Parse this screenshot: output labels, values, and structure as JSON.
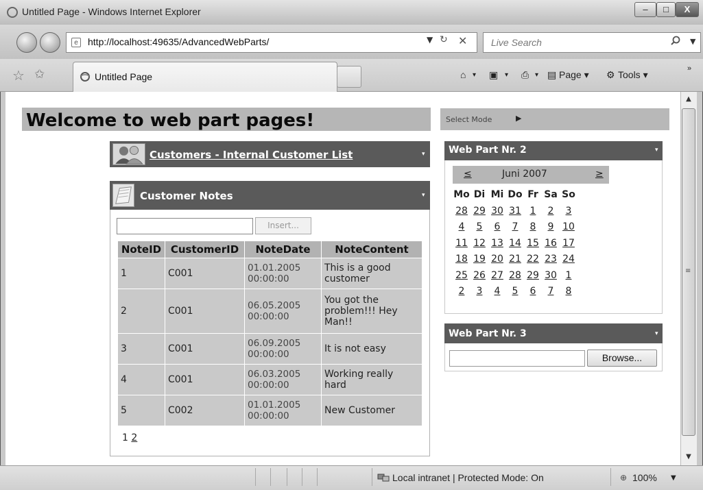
{
  "window": {
    "title": "Untitled Page - Windows Internet Explorer",
    "minimize_glyph": "–",
    "maximize_glyph": "□",
    "close_glyph": "X"
  },
  "browser": {
    "address": "http://localhost:49635/AdvancedWebParts/",
    "search_placeholder": "Live Search",
    "tab_title": "Untitled Page",
    "toolbar": {
      "home_label": "▾",
      "feeds_label": "▾",
      "print_label": "▾",
      "page_label": "Page ▾",
      "tools_label": "Tools ▾",
      "more_label": "»"
    },
    "status": {
      "zone_text": "Local intranet | Protected Mode: On",
      "zoom": "100%"
    }
  },
  "page": {
    "welcome_title": "Welcome to web part pages!",
    "mode_label": "Select Mode",
    "mode_arrow": "▶",
    "customers_part": {
      "title": "Customers - Internal Customer List"
    },
    "notes_part": {
      "title": "Customer Notes",
      "insert_label": "Insert...",
      "columns": [
        "NoteID",
        "CustomerID",
        "NoteDate",
        "NoteContent"
      ],
      "rows": [
        {
          "id": "1",
          "customer": "C001",
          "date": [
            "01.01.2005",
            "00:00:00"
          ],
          "content": [
            "This is a good",
            "customer"
          ]
        },
        {
          "id": "2",
          "customer": "C001",
          "date": [
            "06.05.2005",
            "00:00:00"
          ],
          "content": [
            "You got the",
            "problem!!! Hey",
            "Man!!"
          ]
        },
        {
          "id": "3",
          "customer": "C001",
          "date": [
            "06.09.2005",
            "00:00:00"
          ],
          "content": [
            "It is not easy"
          ]
        },
        {
          "id": "4",
          "customer": "C001",
          "date": [
            "06.03.2005",
            "00:00:00"
          ],
          "content": [
            "Working really",
            "hard"
          ]
        },
        {
          "id": "5",
          "customer": "C002",
          "date": [
            "01.01.2005",
            "00:00:00"
          ],
          "content": [
            "New Customer"
          ]
        }
      ],
      "pager": {
        "current": "1",
        "other": "2"
      }
    },
    "wp2": {
      "title": "Web Part Nr. 2",
      "calendar": {
        "prev": "≤",
        "month": "Juni 2007",
        "next": "≥",
        "days_of_week": [
          "Mo",
          "Di",
          "Mi",
          "Do",
          "Fr",
          "Sa",
          "So"
        ],
        "weeks": [
          [
            "28",
            "29",
            "30",
            "31",
            "1",
            "2",
            "3"
          ],
          [
            "4",
            "5",
            "6",
            "7",
            "8",
            "9",
            "10"
          ],
          [
            "11",
            "12",
            "13",
            "14",
            "15",
            "16",
            "17"
          ],
          [
            "18",
            "19",
            "20",
            "21",
            "22",
            "23",
            "24"
          ],
          [
            "25",
            "26",
            "27",
            "28",
            "29",
            "30",
            "1"
          ],
          [
            "2",
            "3",
            "4",
            "5",
            "6",
            "7",
            "8"
          ]
        ]
      }
    },
    "wp3": {
      "title": "Web Part Nr. 3",
      "browse_label": "Browse..."
    }
  },
  "menu_caret": "▾"
}
